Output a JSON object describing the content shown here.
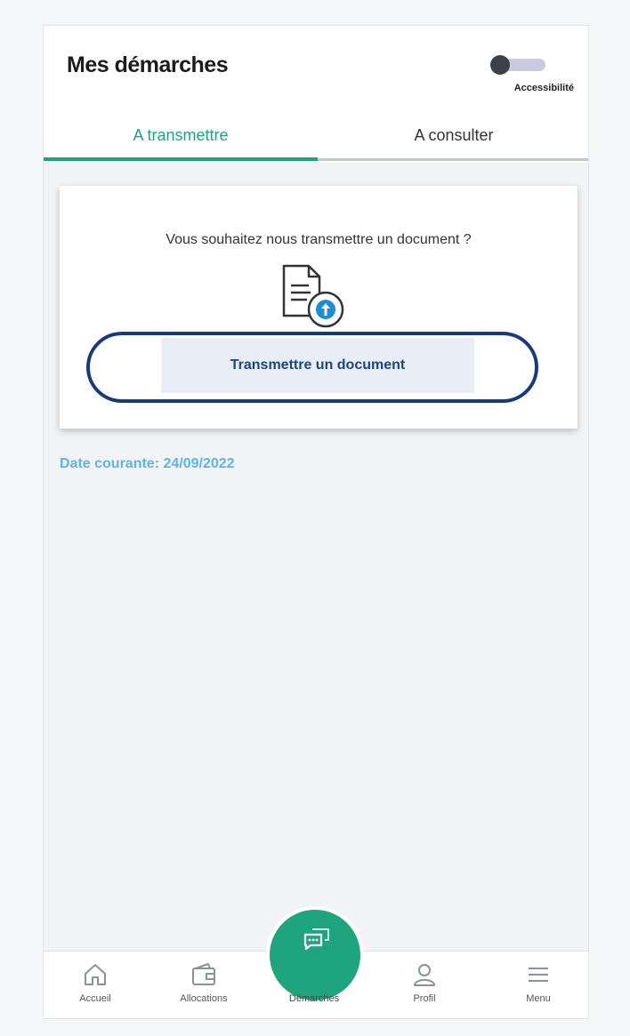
{
  "header": {
    "title": "Mes démarches",
    "accessibility_label": "Accessibilité"
  },
  "tabs": [
    {
      "label": "A transmettre",
      "active": true
    },
    {
      "label": "A consulter",
      "active": false
    }
  ],
  "card": {
    "question": "Vous souhaitez nous transmettre un document ?",
    "button_label": "Transmettre un document"
  },
  "date_label": "Date courante: 24/09/2022",
  "bottom_nav": [
    {
      "label": "Accueil",
      "icon": "home-icon"
    },
    {
      "label": "Allocations",
      "icon": "wallet-icon"
    },
    {
      "label": "Démarches",
      "icon": "document-edit-icon",
      "active": true
    },
    {
      "label": "Profil",
      "icon": "user-icon"
    },
    {
      "label": "Menu",
      "icon": "hamburger-icon"
    }
  ],
  "colors": {
    "accent": "#1ea57d",
    "button_text": "#1b4480",
    "highlight_ring": "#163b7d",
    "date_text": "#5eb3ea"
  }
}
